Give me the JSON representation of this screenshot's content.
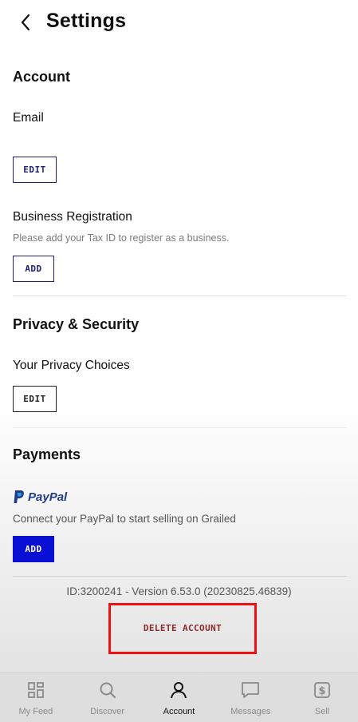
{
  "header": {
    "title": "Settings",
    "back_icon": "chevron-left-icon"
  },
  "account": {
    "title": "Account",
    "email_label": "Email",
    "email_edit": "EDIT",
    "business_label": "Business Registration",
    "business_sub": "Please add your Tax ID to register as a business.",
    "business_add": "ADD"
  },
  "privacy": {
    "title": "Privacy & Security",
    "choices_label": "Your Privacy Choices",
    "choices_edit": "EDIT"
  },
  "payments": {
    "title": "Payments",
    "paypal_logo": "PayPal",
    "paypal_icon": "paypal-icon",
    "paypal_sub": "Connect your PayPal to start selling on Grailed",
    "paypal_add": "ADD",
    "accent": "#0a0fd6"
  },
  "footer": {
    "version": "ID:3200241 - Version 6.53.0 (20230825.46839)",
    "delete_label": "DELETE ACCOUNT",
    "highlight_color": "#ee1111"
  },
  "tabs": [
    {
      "label": "My Feed",
      "icon": "feed-icon",
      "active": false
    },
    {
      "label": "Discover",
      "icon": "search-icon",
      "active": false
    },
    {
      "label": "Account",
      "icon": "person-icon",
      "active": true
    },
    {
      "label": "Messages",
      "icon": "message-icon",
      "active": false
    },
    {
      "label": "Sell",
      "icon": "dollar-icon",
      "active": false
    }
  ]
}
